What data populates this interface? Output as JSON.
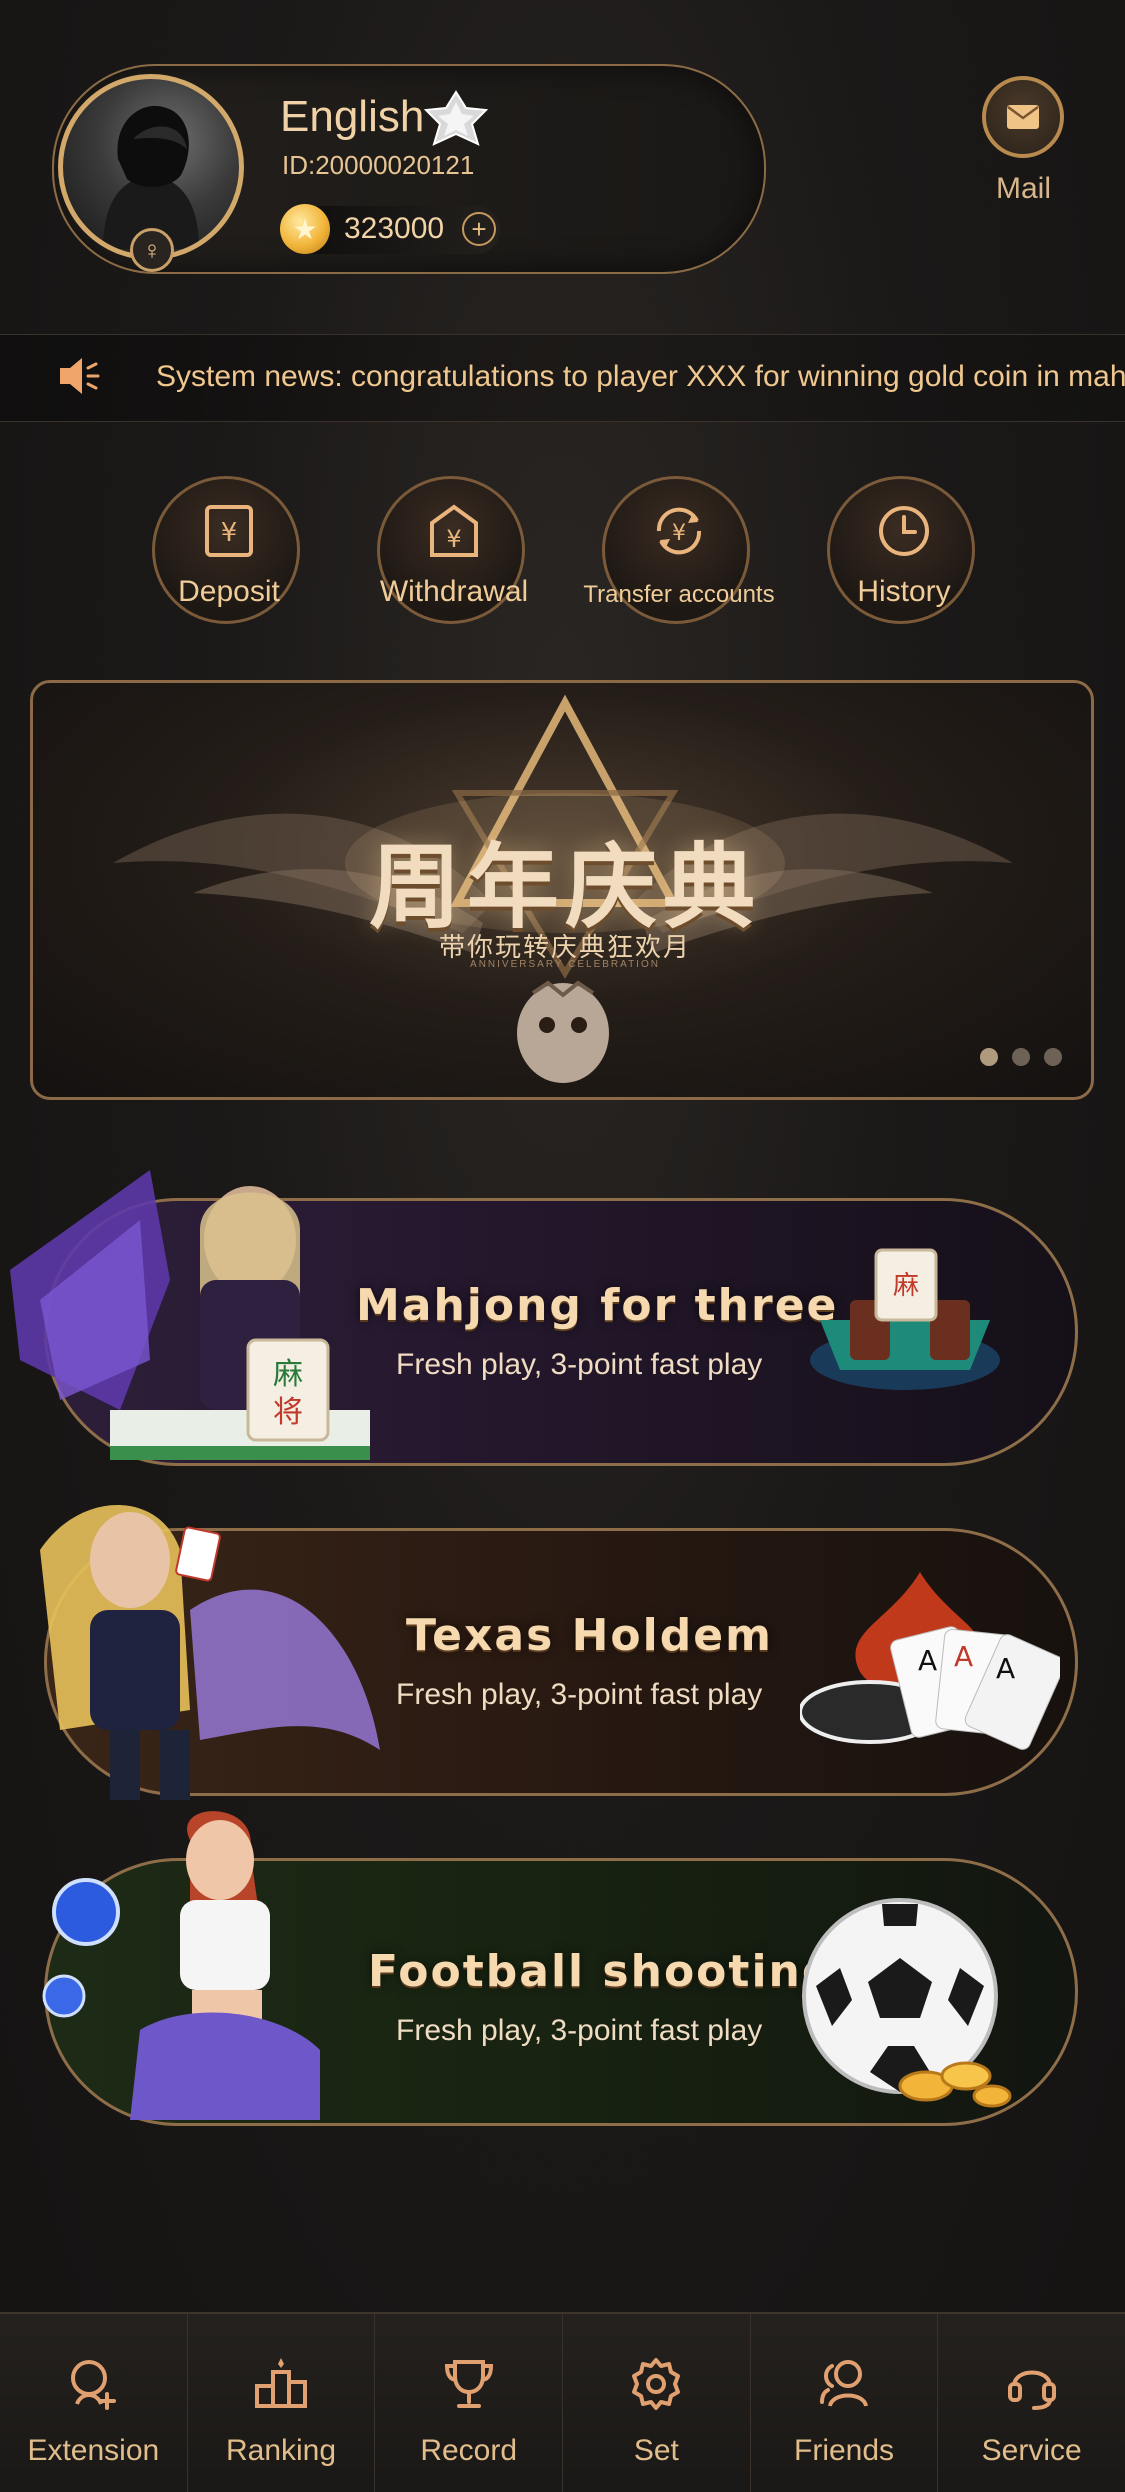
{
  "profile": {
    "username": "English",
    "user_id": "ID:20000020121",
    "coins": "323000",
    "gender_symbol": "♀"
  },
  "header": {
    "mail_label": "Mail"
  },
  "news": {
    "text": "System news: congratulations to player XXX for winning gold coin in mahjo"
  },
  "actions": [
    {
      "label": "Deposit",
      "icon": "deposit-icon"
    },
    {
      "label": "Withdrawal",
      "icon": "withdrawal-icon"
    },
    {
      "label": "Transfer accounts",
      "icon": "transfer-icon"
    },
    {
      "label": "History",
      "icon": "history-icon"
    }
  ],
  "banner": {
    "title": "周年庆典",
    "subtitle": "带你玩转庆典狂欢月",
    "small_text": "ANNIVERSARY CELEBRATION",
    "slides": 3,
    "active_slide": 1
  },
  "games": [
    {
      "title": "Mahjong for three",
      "subtitle": "Fresh play, 3-point fast play",
      "tile_text": "麻将"
    },
    {
      "title": "Texas Holdem",
      "subtitle": "Fresh play, 3-point fast play"
    },
    {
      "title": "Football shooting",
      "subtitle": "Fresh play, 3-point fast play"
    }
  ],
  "nav": [
    {
      "label": "Extension",
      "icon": "extension-icon"
    },
    {
      "label": "Ranking",
      "icon": "ranking-icon"
    },
    {
      "label": "Record",
      "icon": "trophy-icon"
    },
    {
      "label": "Set",
      "icon": "gear-icon"
    },
    {
      "label": "Friends",
      "icon": "friends-icon"
    },
    {
      "label": "Service",
      "icon": "headset-icon"
    }
  ],
  "colors": {
    "accent": "#d3a96b",
    "text_gold": "#f0cc98",
    "background": "#1b1918"
  }
}
